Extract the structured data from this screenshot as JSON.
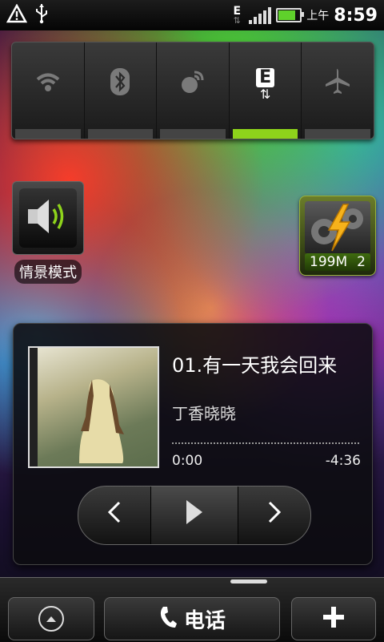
{
  "status_bar": {
    "net_type": "E",
    "ampm": "上午",
    "time": "8:59",
    "battery_level": 0.8
  },
  "quick_settings": {
    "toggles": [
      {
        "name": "wifi",
        "icon": "wifi-icon",
        "on": false
      },
      {
        "name": "bluetooth",
        "icon": "bluetooth-icon",
        "on": false
      },
      {
        "name": "gps",
        "icon": "gps-icon",
        "on": false
      },
      {
        "name": "mobile-data",
        "icon": "mobile-data-icon",
        "on": true
      },
      {
        "name": "airplane",
        "icon": "airplane-icon",
        "on": false
      }
    ],
    "mobile_data_label": "E"
  },
  "profile_widget": {
    "label": "情景模式",
    "icon": "speaker-icon"
  },
  "task_manager": {
    "memory": "199M",
    "count": "2",
    "icon": "lightning-gear-icon"
  },
  "music": {
    "title": "01.有一天我会回来",
    "artist": "丁香晓晓",
    "elapsed": "0:00",
    "remaining": "-4:36",
    "progress": 0.0
  },
  "dock": {
    "phone_label": "电话",
    "launcher_icon": "up-arrow-icon",
    "add_icon": "plus-icon"
  },
  "colors": {
    "toggle_on": "#8ed31b",
    "battery_fill": "#5fd12b"
  }
}
